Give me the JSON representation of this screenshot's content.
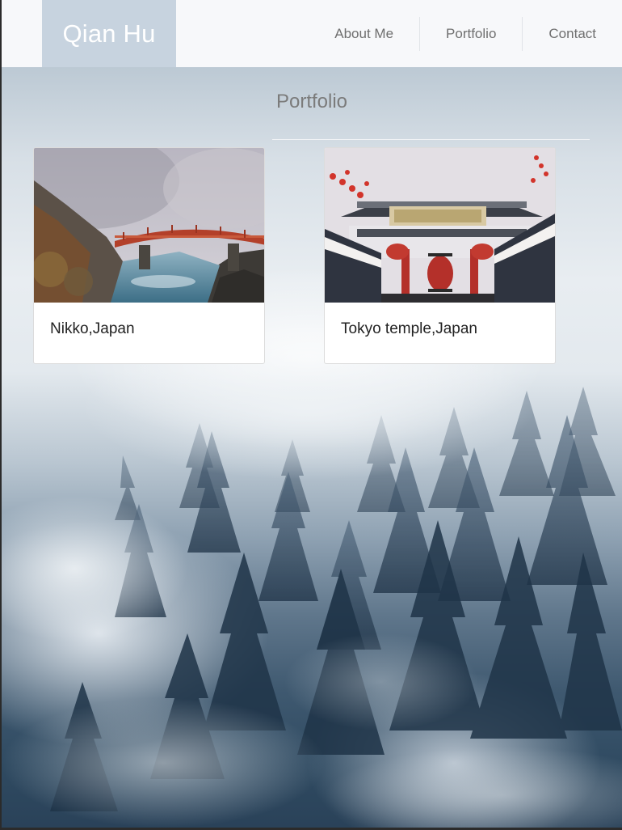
{
  "header": {
    "brand": "Qian Hu",
    "nav": [
      {
        "label": "About Me"
      },
      {
        "label": "Portfolio"
      },
      {
        "label": "Contact"
      }
    ]
  },
  "portfolio": {
    "title": "Portfolio",
    "cards": [
      {
        "title": "Nikko,Japan",
        "image": "red-bridge-over-misty-river-photo"
      },
      {
        "title": "Tokyo temple,Japan",
        "image": "temple-gate-with-lanterns-photo"
      }
    ]
  },
  "background": {
    "image": "misty-pine-forest-photo"
  }
}
